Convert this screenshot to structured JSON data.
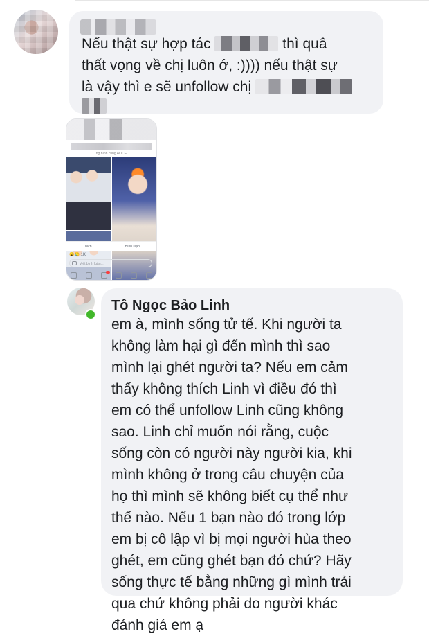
{
  "comment1": {
    "text_line1_a": "Nếu thật sự hợp tác ",
    "text_line1_b": " thì quâ",
    "text_line2": "thất vọng về chị luôn ớ, :)))) nếu thật sự",
    "text_line3": "là vậy thì e sẽ unfollow chị "
  },
  "attachment": {
    "caption": "ng hình cùng ALICE",
    "like_label": "Thích",
    "comment_label": "Bình luận",
    "reaction_count": "1K",
    "write_placeholder": "Viết bình luận..."
  },
  "comment2": {
    "author": "Tô Ngọc Bảo Linh",
    "lines": [
      "em à, mình sống tử tế. Khi người ta",
      "không làm hại gì đến mình thì sao",
      "mình lại ghét người ta? Nếu em cảm",
      "thấy không thích Linh vì điều đó thì",
      "em có thể unfollow Linh cũng không",
      "sao. Linh chỉ muốn nói rằng, cuộc",
      "sống còn có người này người kia, khi",
      "mình không ở trong câu chuyện của",
      "họ thì mình sẽ không biết cụ thể như",
      "thế nào. Nếu 1 bạn nào đó trong lớp",
      "em bị cô lập vì bị mọi người hùa theo",
      "ghét, em cũng ghét bạn đó chứ? Hãy",
      "sống thực tế bằng những gì mình trải",
      "qua chứ không phải do người khác",
      "đánh giá em ạ"
    ]
  },
  "colors": {
    "bubble": "#f1f2f5",
    "text": "#1c1e21",
    "online": "#42b72a"
  }
}
